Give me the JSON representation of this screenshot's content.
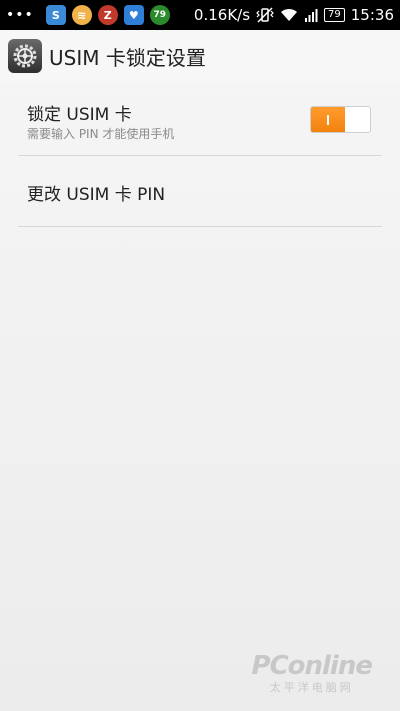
{
  "status_bar": {
    "dots": "•••",
    "apps": [
      {
        "name": "360-security-icon",
        "label": "S"
      },
      {
        "name": "burger-app-icon",
        "label": "≋"
      },
      {
        "name": "z-app-icon",
        "label": "Z"
      },
      {
        "name": "shield-app-icon",
        "label": "♥"
      },
      {
        "name": "badge-79-icon",
        "label": "79"
      }
    ],
    "speed": "0.16K/s",
    "battery": "79",
    "time": "15:36"
  },
  "header": {
    "title": "USIM 卡锁定设置"
  },
  "settings": {
    "lock_title": "锁定 USIM 卡",
    "lock_subtitle": "需要输入 PIN 才能使用手机",
    "lock_enabled": true,
    "change_pin_title": "更改 USIM 卡 PIN"
  },
  "watermark": {
    "logo": "PConline",
    "sub": "太平洋电脑网"
  },
  "colors": {
    "accent": "#f68a1e",
    "statusbar": "#000000",
    "divider": "#d8d8d8"
  }
}
